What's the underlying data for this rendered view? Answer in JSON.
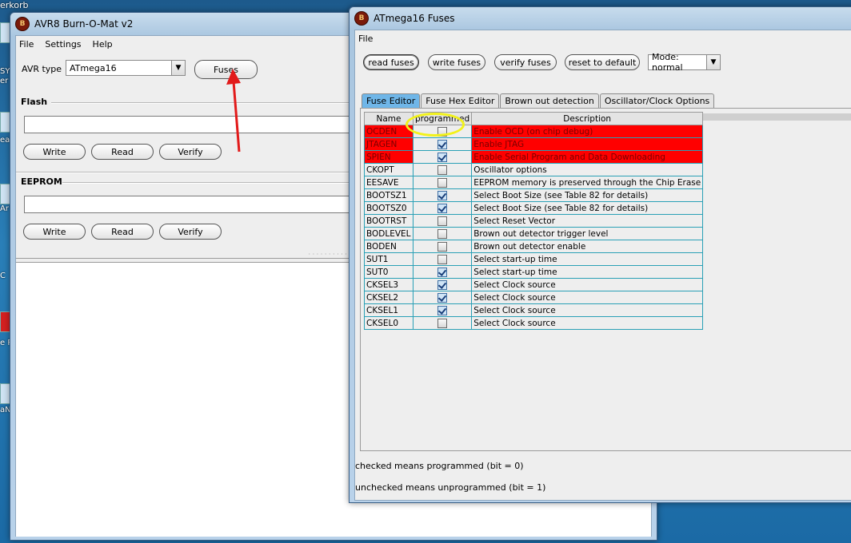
{
  "desktop": {
    "corner_label": "erkorb",
    "side_labels": [
      "SY",
      "er",
      "ea",
      "Ar",
      "C",
      "e R",
      "aN"
    ]
  },
  "burn_window": {
    "title": "AVR8 Burn-O-Mat v2",
    "menu": [
      "File",
      "Settings",
      "Help"
    ],
    "avr_type_label": "AVR type",
    "avr_type_value": "ATmega16",
    "fuses_button": "Fuses",
    "flash_title": "Flash",
    "eeprom_title": "EEPROM",
    "flash_buttons": {
      "write": "Write",
      "read": "Read",
      "verify": "Verify"
    },
    "eeprom_buttons": {
      "write": "Write",
      "read": "Read",
      "verify": "Verify"
    }
  },
  "fuses_window": {
    "title": "ATmega16 Fuses",
    "menu": [
      "File"
    ],
    "toolbar": {
      "read": "read fuses",
      "write": "write fuses",
      "verify": "verify fuses",
      "reset": "reset to default",
      "mode": "Mode: normal"
    },
    "tabs": [
      "Fuse Editor",
      "Fuse Hex Editor",
      "Brown out detection",
      "Oscillator/Clock Options"
    ],
    "active_tab": "Fuse Editor",
    "table_headers": [
      "Name",
      "programmed",
      "Description"
    ],
    "rows": [
      {
        "name": "OCDEN",
        "programmed": false,
        "desc": "Enable OCD (on chip debug)",
        "highlight": true
      },
      {
        "name": "JTAGEN",
        "programmed": true,
        "desc": "Enable JTAG",
        "highlight": true
      },
      {
        "name": "SPIEN",
        "programmed": true,
        "desc": "Enable Serial Program and Data Downloading",
        "highlight": true
      },
      {
        "name": "CKOPT",
        "programmed": false,
        "desc": "Oscillator options",
        "highlight": false
      },
      {
        "name": "EESAVE",
        "programmed": false,
        "desc": "EEPROM memory is preserved through the Chip Erase",
        "highlight": false
      },
      {
        "name": "BOOTSZ1",
        "programmed": true,
        "desc": "Select Boot Size (see Table 82 for details)",
        "highlight": false
      },
      {
        "name": "BOOTSZ0",
        "programmed": true,
        "desc": "Select Boot Size (see Table 82 for details)",
        "highlight": false
      },
      {
        "name": "BOOTRST",
        "programmed": false,
        "desc": "Select Reset Vector",
        "highlight": false
      },
      {
        "name": "BODLEVEL",
        "programmed": false,
        "desc": "Brown out detector trigger level",
        "highlight": false
      },
      {
        "name": "BODEN",
        "programmed": false,
        "desc": "Brown out detector enable",
        "highlight": false
      },
      {
        "name": "SUT1",
        "programmed": false,
        "desc": "Select start-up time",
        "highlight": false
      },
      {
        "name": "SUT0",
        "programmed": true,
        "desc": "Select start-up time",
        "highlight": false
      },
      {
        "name": "CKSEL3",
        "programmed": true,
        "desc": "Select Clock source",
        "highlight": false
      },
      {
        "name": "CKSEL2",
        "programmed": true,
        "desc": "Select Clock source",
        "highlight": false
      },
      {
        "name": "CKSEL1",
        "programmed": true,
        "desc": "Select Clock source",
        "highlight": false
      },
      {
        "name": "CKSEL0",
        "programmed": false,
        "desc": "Select Clock source",
        "highlight": false
      }
    ],
    "note_checked": "checked means programmed (bit = 0)",
    "note_unchecked": "unchecked means unprogrammed (bit = 1)"
  },
  "colors": {
    "danger_row": "#ff0000",
    "annotation_arrow": "#e21a1a",
    "annotation_circle": "#f2f21a",
    "active_tab": "#6fb6e8"
  }
}
